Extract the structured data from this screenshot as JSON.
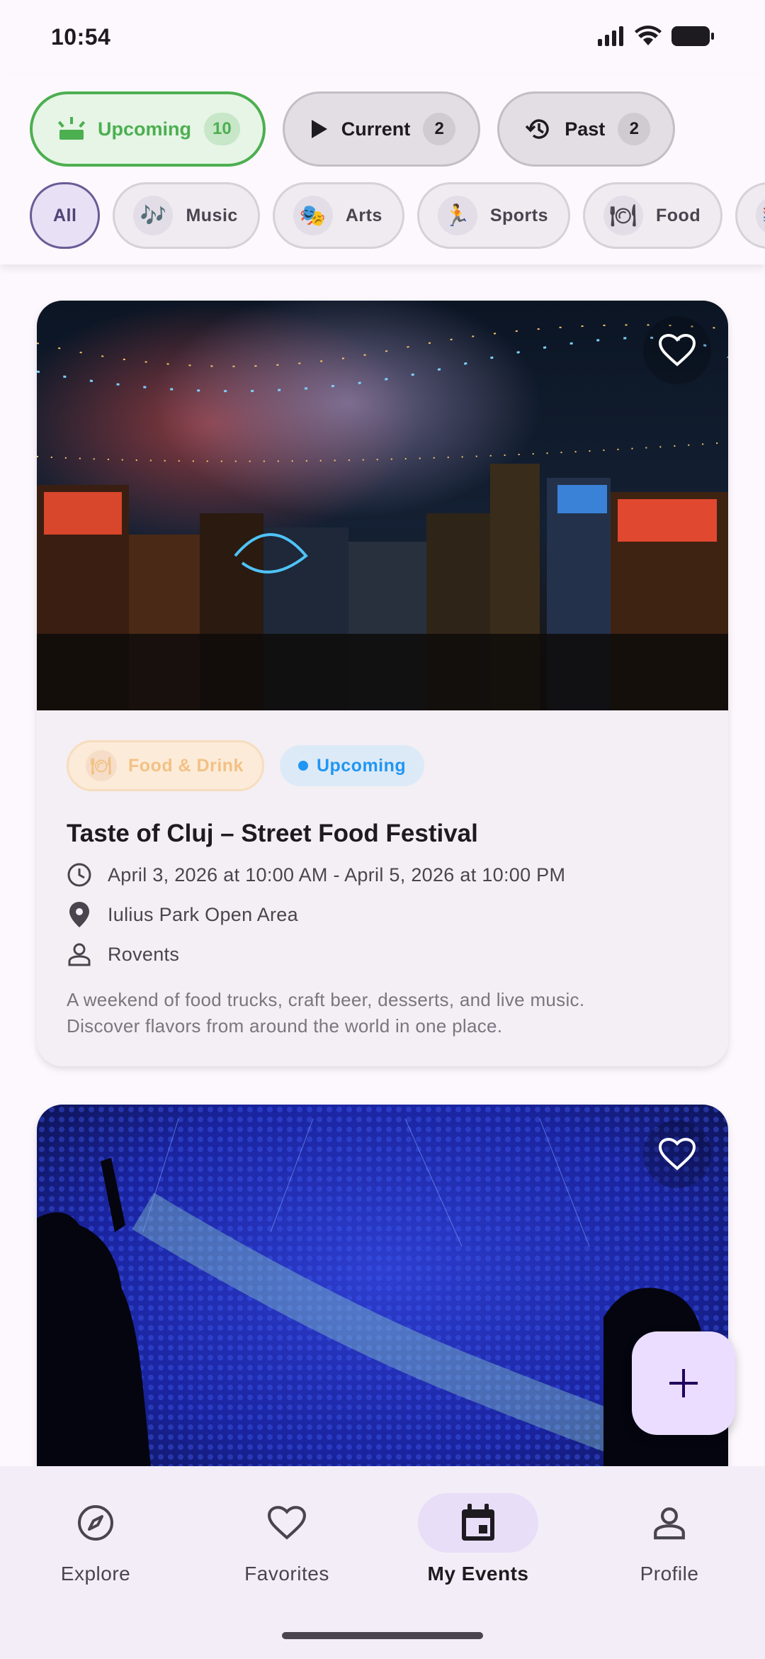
{
  "status_bar": {
    "time": "10:54"
  },
  "status_filters": [
    {
      "label": "Upcoming",
      "count": "10"
    },
    {
      "label": "Current",
      "count": "2"
    },
    {
      "label": "Past",
      "count": "2"
    }
  ],
  "category_filters": [
    {
      "label": "All"
    },
    {
      "label": "Music",
      "icon": "music-notes-icon"
    },
    {
      "label": "Arts",
      "icon": "theater-masks-icon"
    },
    {
      "label": "Sports",
      "icon": "runner-icon"
    },
    {
      "label": "Food",
      "icon": "food-icon"
    }
  ],
  "events": [
    {
      "category": "Food & Drink",
      "status": "Upcoming",
      "title": "Taste of Cluj – Street Food Festival",
      "datetime": "April 3, 2026 at 10:00 AM - April 5, 2026 at 10:00 PM",
      "location": "Iulius Park Open Area",
      "organizer": "Rovents",
      "description_line1": "A weekend of food trucks, craft beer, desserts, and live music.",
      "description_line2": "Discover flavors from around the world in one place."
    }
  ],
  "bottom_nav": [
    {
      "label": "Explore",
      "icon": "compass-icon"
    },
    {
      "label": "Favorites",
      "icon": "heart-icon"
    },
    {
      "label": "My Events",
      "icon": "calendar-icon",
      "active": true
    },
    {
      "label": "Profile",
      "icon": "person-icon"
    }
  ],
  "colors": {
    "accent": "#4CAF50",
    "status_blue": "#2196F3",
    "nav_active": "#E8DEF8",
    "fab": "#EADDFF"
  }
}
